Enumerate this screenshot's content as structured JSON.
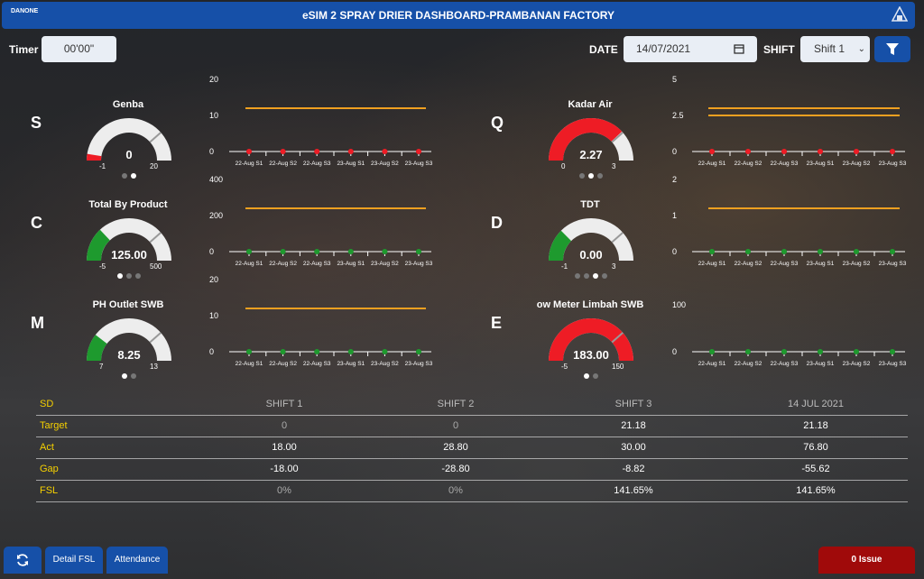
{
  "header": {
    "title": "eSIM 2 SPRAY DRIER DASHBOARD-PRAMBANAN FACTORY",
    "logo_text": "DANONE"
  },
  "timer": {
    "label": "Timer",
    "value": "00'00\""
  },
  "date": {
    "label": "DATE",
    "value": "14/07/2021"
  },
  "shift": {
    "label": "SHIFT",
    "selected": "Shift 1"
  },
  "colors": {
    "accent": "#1650a8",
    "red": "#ee1c25",
    "green": "#1e9a2e",
    "orange": "#f0a020",
    "yellow": "#f5d000"
  },
  "panels": [
    {
      "letter": "S",
      "gauge": {
        "title": "Genba",
        "value": "0",
        "min": "-1",
        "max": "20",
        "fraction": 0.05,
        "color": "#ee1c25",
        "dots": [
          false,
          true
        ]
      },
      "mini": {
        "ylabels": [
          "20",
          "10",
          "0"
        ],
        "ticks": [
          "22-Aug S1",
          "22-Aug S2",
          "22-Aug S3",
          "23-Aug S1",
          "23-Aug S2",
          "23-Aug S3"
        ],
        "markerColor": "#ee1c25"
      }
    },
    {
      "letter": "Q",
      "gauge": {
        "title": "Kadar Air",
        "value": "2.27",
        "min": "0",
        "max": "3",
        "fraction": 0.76,
        "color": "#ee1c25",
        "dots": [
          false,
          true,
          false
        ]
      },
      "mini": {
        "ylabels": [
          "5",
          "2.5",
          "0"
        ],
        "ticks": [
          "22-Aug S1",
          "22-Aug S2",
          "22-Aug S3",
          "23-Aug S1",
          "23-Aug S2",
          "23-Aug S3"
        ],
        "markerColor": "#ee1c25"
      }
    },
    {
      "letter": "C",
      "gauge": {
        "title": "Total By Product",
        "value": "125.00",
        "min": "-5",
        "max": "500",
        "fraction": 0.26,
        "color": "#1e9a2e",
        "dots": [
          true,
          false,
          false
        ]
      },
      "mini": {
        "ylabels": [
          "400",
          "200",
          "0"
        ],
        "ticks": [
          "22-Aug S1",
          "22-Aug S2",
          "22-Aug S3",
          "23-Aug S1",
          "23-Aug S2",
          "23-Aug S3"
        ],
        "markerColor": "#1e9a2e"
      }
    },
    {
      "letter": "D",
      "gauge": {
        "title": "TDT",
        "value": "0.00",
        "min": "-1",
        "max": "3",
        "fraction": 0.25,
        "color": "#1e9a2e",
        "dots": [
          false,
          false,
          true,
          false
        ]
      },
      "mini": {
        "ylabels": [
          "2",
          "1",
          "0"
        ],
        "ticks": [
          "22-Aug S1",
          "22-Aug S2",
          "22-Aug S3",
          "23-Aug S1",
          "23-Aug S2",
          "23-Aug S3"
        ],
        "markerColor": "#1e9a2e"
      }
    },
    {
      "letter": "M",
      "gauge": {
        "title": "PH Outlet SWB",
        "value": "8.25",
        "min": "7",
        "max": "13",
        "fraction": 0.21,
        "color": "#1e9a2e",
        "dots": [
          true,
          false
        ]
      },
      "mini": {
        "ylabels": [
          "20",
          "10",
          "0"
        ],
        "ticks": [
          "22-Aug S1",
          "22-Aug S2",
          "22-Aug S3",
          "23-Aug S1",
          "23-Aug S2",
          "23-Aug S3"
        ],
        "markerColor": "#1e9a2e"
      }
    },
    {
      "letter": "E",
      "gauge": {
        "title": "ow Meter Limbah SWB",
        "value": "183.00",
        "min": "-5",
        "max": "150",
        "fraction": 1.0,
        "color": "#ee1c25",
        "dots": [
          true,
          false
        ]
      },
      "mini": {
        "ylabels": [
          "100",
          "0"
        ],
        "ticks": [
          "22-Aug S1",
          "22-Aug S2",
          "22-Aug S3",
          "23-Aug S1",
          "23-Aug S2",
          "23-Aug S3"
        ],
        "markerColor": "#1e9a2e"
      }
    }
  ],
  "table": {
    "headers": [
      "SD",
      "SHIFT 1",
      "SHIFT 2",
      "SHIFT 3",
      "14 JUL 2021"
    ],
    "rows": [
      {
        "label": "Target",
        "values": [
          "0",
          "0",
          "21.18",
          "21.18"
        ]
      },
      {
        "label": "Act",
        "values": [
          "18.00",
          "28.80",
          "30.00",
          "76.80"
        ]
      },
      {
        "label": "Gap",
        "values": [
          "-18.00",
          "-28.80",
          "-8.82",
          "-55.62"
        ]
      },
      {
        "label": "FSL",
        "values": [
          "0%",
          "0%",
          "141.65%",
          "141.65%"
        ]
      }
    ]
  },
  "footer": {
    "detail_fsl": "Detail FSL",
    "attendance": "Attendance",
    "issue": "0 Issue"
  }
}
